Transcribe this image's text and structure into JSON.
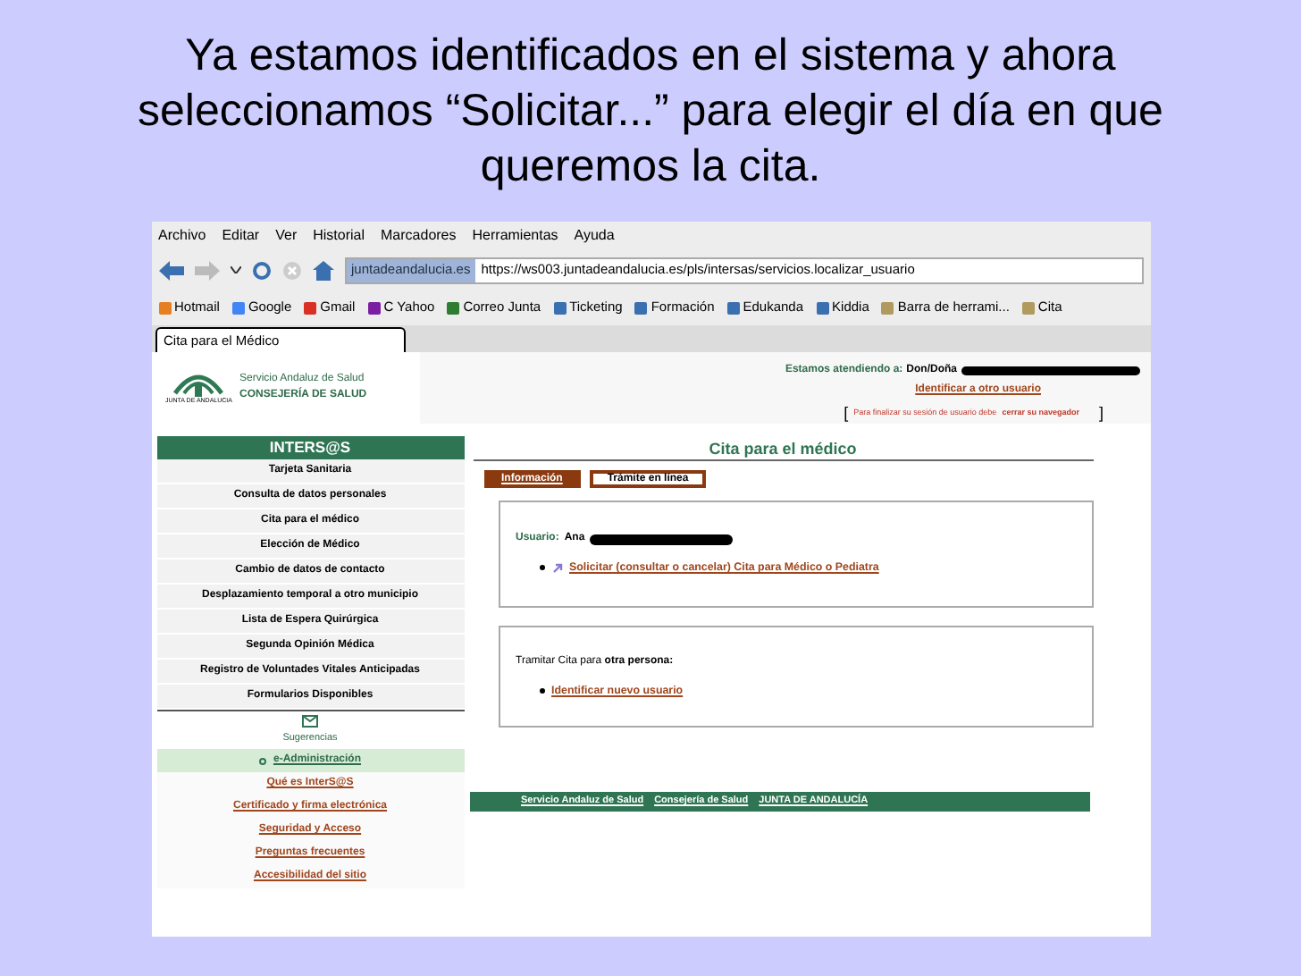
{
  "slide": {
    "title": "Ya estamos identificados en el sistema y ahora seleccionamos “Solicitar...” para elegir el día en que queremos la cita."
  },
  "browser": {
    "menu": [
      "Archivo",
      "Editar",
      "Ver",
      "Historial",
      "Marcadores",
      "Herramientas",
      "Ayuda"
    ],
    "url_domain": "juntadeandalucia.es",
    "url": "https://ws003.juntadeandalucia.es/pls/intersas/servicios.localizar_usuario",
    "bookmarks": [
      "Hotmail",
      "Google",
      "Gmail",
      "C Yahoo",
      "Correo Junta",
      "Ticketing",
      "Formación",
      "Edukanda",
      "Kiddia",
      "Barra de herrami...",
      "Cita"
    ],
    "tab_title": "Cita para el Médico"
  },
  "header": {
    "logo_caption": "JUNTA DE ANDALUCIA",
    "org_line_1": "Servicio Andaluz de Salud",
    "org_line_2": "CONSEJERÍA DE SALUD",
    "attending_label": "Estamos atendiendo a:",
    "attending_value": "Don/Doña",
    "identify_link": "Identificar a otro usuario",
    "bracket_open": "[",
    "end_session_text": "Para finalizar su sesión de usuario debe",
    "end_session_link": "cerrar su navegador",
    "bracket_close": "]"
  },
  "sidebar": {
    "title": "INTERS@S",
    "items": [
      {
        "label": "Tarjeta Sanitaria",
        "kind": "menu",
        "selected": false
      },
      {
        "label": "Consulta de datos personales",
        "kind": "menu",
        "selected": false
      },
      {
        "label": "Cita para el médico",
        "kind": "menu",
        "selected": false
      },
      {
        "label": "Elección de Médico",
        "kind": "menu",
        "selected": false
      },
      {
        "label": "Cambio de datos de contacto",
        "kind": "menu",
        "selected": false
      },
      {
        "label": "Desplazamiento temporal a otro municipio",
        "kind": "menu",
        "selected": false
      },
      {
        "label": "Lista de Espera Quirúrgica",
        "kind": "menu",
        "selected": false
      },
      {
        "label": "Segunda Opinión Médica",
        "kind": "menu",
        "selected": false
      },
      {
        "label": "Registro de Voluntades Vitales Anticipadas",
        "kind": "menu",
        "selected": false
      },
      {
        "label": "Formularios Disponibles",
        "kind": "menu",
        "selected": false
      },
      {
        "label": "Sugerencias",
        "kind": "suggest",
        "selected": false
      },
      {
        "label": "e-Administración",
        "kind": "admin",
        "selected": true
      },
      {
        "label": "Qué es InterS@S",
        "kind": "link",
        "selected": false
      },
      {
        "label": "Certificado y firma electrónica",
        "kind": "link",
        "selected": false
      },
      {
        "label": "Seguridad y Acceso",
        "kind": "link",
        "selected": false
      },
      {
        "label": "Preguntas frecuentes",
        "kind": "link",
        "selected": false
      },
      {
        "label": "Accesibilidad del sitio",
        "kind": "link",
        "selected": false
      }
    ]
  },
  "main": {
    "title": "Cita para el médico",
    "tabs": [
      {
        "label": "Información",
        "selected": true
      },
      {
        "label": "Trámite en línea",
        "selected": false
      }
    ],
    "user_box": {
      "label": "Usuario:",
      "name": "Ana",
      "link": "Solicitar (consultar o cancelar) Cita para Médico o Pediatra"
    },
    "other_box": {
      "text": "Tramitar Cita para **otra persona:**",
      "link": "Identificar nuevo usuario"
    },
    "footer_links": [
      "Servicio Andaluz de Salud",
      "Consejería de Salud",
      "JUNTA DE ANDALUCÍA"
    ]
  }
}
